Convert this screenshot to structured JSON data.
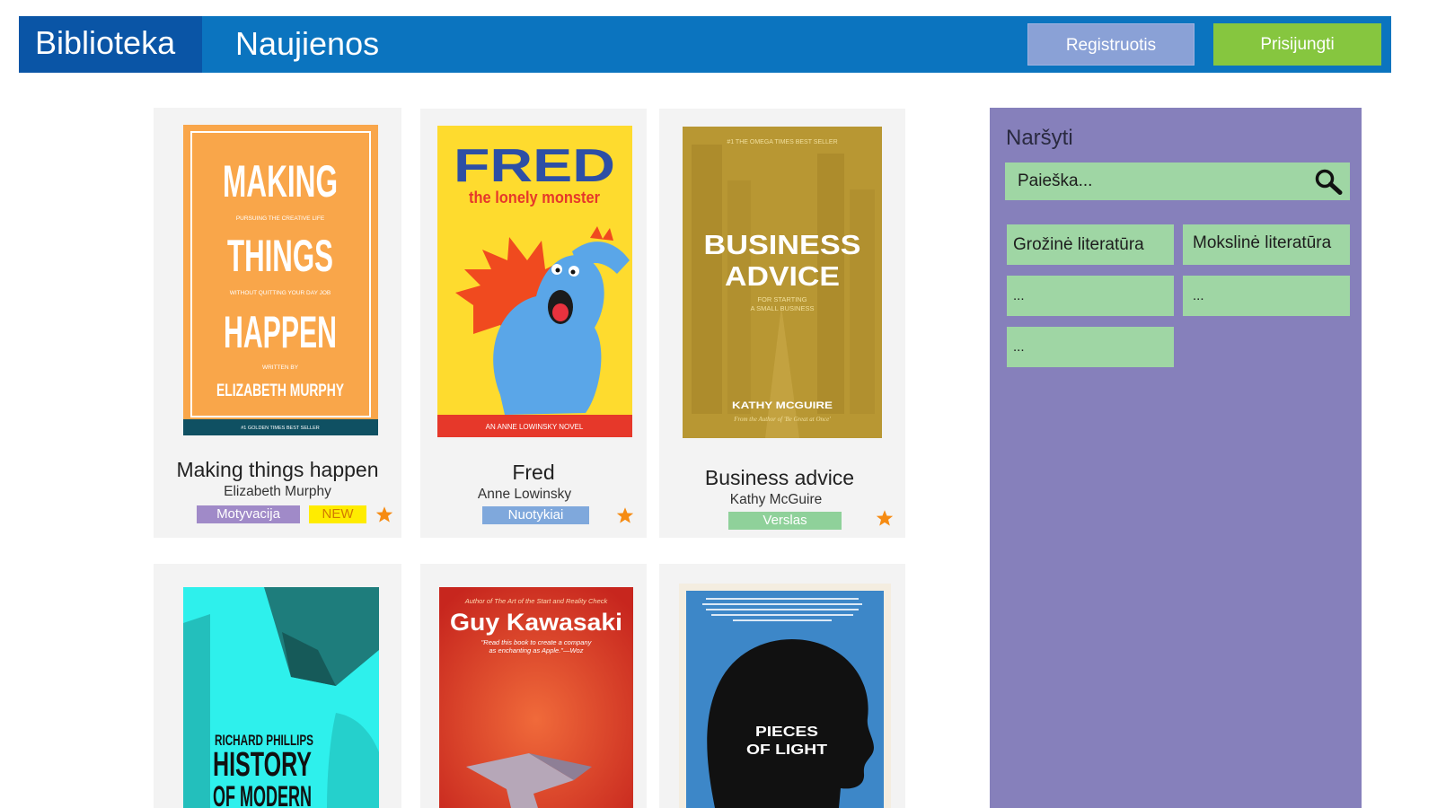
{
  "header": {
    "brand": "Biblioteka",
    "nav_link": "Naujienos",
    "register_label": "Registruotis",
    "login_label": "Prisijungti",
    "colors": {
      "bar": "#0b74bf",
      "brand_bg": "#0a55a6",
      "register": "#8aa1d6",
      "login": "#86c63f"
    }
  },
  "books": [
    {
      "title": "Making things happen",
      "author": "Elizabeth Murphy",
      "tags": [
        {
          "label": "Motyvacija",
          "color": "#a08ac8"
        },
        {
          "label": "NEW",
          "color": "#ffec00"
        }
      ],
      "favorite_icon": "star-icon",
      "cover": {
        "line1": "MAKING",
        "line2": "THINGS",
        "line3": "HAPPEN",
        "sub1": "PURSUING THE CREATIVE LIFE",
        "sub2": "WITHOUT QUITTING YOUR DAY JOB",
        "written_by": "WRITTEN BY",
        "author": "ELIZABETH MURPHY",
        "footer": "#1 GOLDEN TIMES BEST SELLER"
      }
    },
    {
      "title": "Fred",
      "author": "Anne Lowinsky",
      "tags": [
        {
          "label": "Nuotykiai",
          "color": "#7fa8dc"
        }
      ],
      "favorite_icon": "star-icon",
      "cover": {
        "title": "FRED",
        "subtitle": "the lonely monster",
        "footer": "AN ANNE LOWINSKY NOVEL"
      }
    },
    {
      "title": "Business advice",
      "author": "Kathy McGuire",
      "tags": [
        {
          "label": "Verslas",
          "color": "#8fd19a"
        }
      ],
      "favorite_icon": "star-icon",
      "cover": {
        "top": "#1 THE OMEGA TIMES BEST SELLER",
        "line1": "BUSINESS",
        "line2": "ADVICE",
        "sub1": "FOR STARTING",
        "sub2": "A SMALL BUSINESS",
        "author": "KATHY MCGUIRE",
        "tagline": "From the Author of 'Be Great at Once'"
      }
    },
    {
      "cover": {
        "author": "RICHARD PHILLIPS",
        "line1": "HISTORY",
        "line2": "OF MODERN"
      }
    },
    {
      "cover": {
        "top": "Author of The Art of the Start and Reality Check",
        "title": "Guy Kawasaki",
        "quote1": "\"Read this book to create a company",
        "quote2": "as enchanting as Apple.\"—Woz"
      }
    },
    {
      "cover": {
        "line1": "PIECES",
        "line2": "OF LIGHT"
      }
    }
  ],
  "sidebar": {
    "title": "Naršyti",
    "search": {
      "placeholder": "Paieška...",
      "icon": "search-icon"
    },
    "categories": [
      "Grožinė literatūra",
      "Mokslinė literatūra",
      "...",
      "...",
      "..."
    ]
  }
}
